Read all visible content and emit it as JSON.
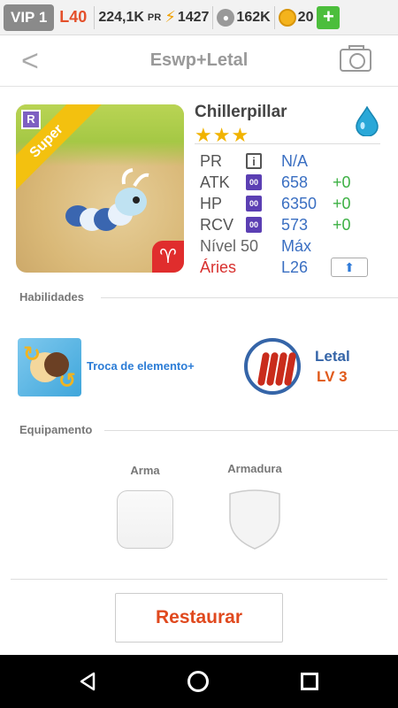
{
  "topbar": {
    "vip": "VIP 1",
    "level": "L40",
    "pr_value": "224,1K",
    "pr_label": "PR",
    "energy": "1427",
    "food": "162K",
    "coins": "20",
    "plus": "+"
  },
  "header": {
    "back": "<",
    "title": "Eswp+Letal"
  },
  "monster": {
    "name": "Chillerpillar",
    "rarity_badge": "R",
    "rank_ribbon": "Super",
    "zodiac_symbol": "♈",
    "stars": "★★★",
    "element_color": "#2aa8d8",
    "stats": {
      "pr_label": "PR",
      "pr_value": "N/A",
      "info_icon": "i",
      "atk_label": "ATK",
      "atk_value": "658",
      "atk_bonus": "+0",
      "hp_label": "HP",
      "hp_value": "6350",
      "hp_bonus": "+0",
      "rcv_label": "RCV",
      "rcv_value": "573",
      "rcv_bonus": "+0",
      "tag": "00",
      "level_label": "Nível 50",
      "level_value": "Máx",
      "sign_label": "Áries",
      "sign_level": "L26",
      "up_arrow": "⬆"
    }
  },
  "abilities": {
    "section_title": "Habilidades",
    "skill_name": "Troca de elemento+",
    "passive_name": "Letal",
    "passive_level": "LV 3"
  },
  "equipment": {
    "section_title": "Equipamento",
    "weapon_label": "Arma",
    "armor_label": "Armadura"
  },
  "actions": {
    "restore_label": "Restaurar"
  }
}
